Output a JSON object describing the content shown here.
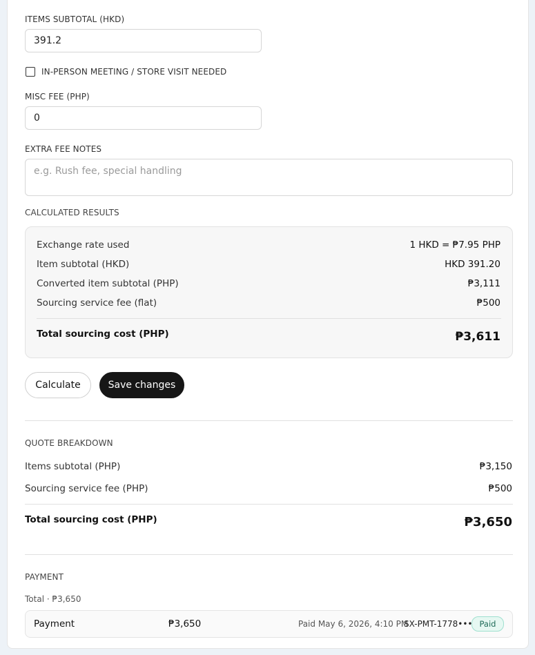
{
  "form": {
    "items_subtotal_label": "ITEMS SUBTOTAL (HKD)",
    "items_subtotal_value": "391.2",
    "in_person_label": "IN-PERSON MEETING / STORE VISIT NEEDED",
    "in_person_checked": false,
    "misc_fee_label": "MISC FEE (PHP)",
    "misc_fee_value": "0",
    "extra_fee_notes_label": "EXTRA FEE NOTES",
    "extra_fee_notes_placeholder": "e.g. Rush fee, special handling"
  },
  "calculated": {
    "section_label": "CALCULATED RESULTS",
    "rows": [
      {
        "label": "Exchange rate used",
        "value": "1 HKD = ₱7.95 PHP"
      },
      {
        "label": "Item subtotal (HKD)",
        "value": "HKD 391.20"
      },
      {
        "label": "Converted item subtotal (PHP)",
        "value": "₱3,111"
      },
      {
        "label": "Sourcing service fee (flat)",
        "value": "₱500"
      }
    ],
    "total_label": "Total sourcing cost (PHP)",
    "total_value": "₱3,611"
  },
  "actions": {
    "calculate_label": "Calculate",
    "save_label": "Save changes"
  },
  "quote": {
    "section_label": "QUOTE BREAKDOWN",
    "rows": [
      {
        "label": "Items subtotal (PHP)",
        "value": "₱3,150"
      },
      {
        "label": "Sourcing service fee (PHP)",
        "value": "₱500"
      }
    ],
    "total_label": "Total sourcing cost (PHP)",
    "total_value": "₱3,650"
  },
  "payment": {
    "section_label": "PAYMENT",
    "total_line": "Total · ₱3,650",
    "entry": {
      "name": "Payment",
      "amount": "₱3,650",
      "paid_date": "Paid May 6, 2026, 4:10 PM",
      "reference": "SX-PMT-1778••••",
      "status": "Paid"
    }
  },
  "colors": {
    "primary_button": "#161616",
    "paid_badge_bg": "#e6f8f2",
    "paid_badge_border": "#9fe0cf",
    "page_bg": "#edf2f7"
  }
}
